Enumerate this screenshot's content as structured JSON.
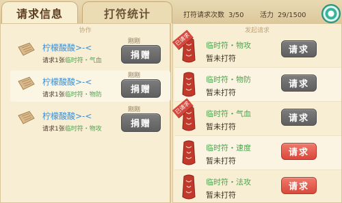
{
  "tabs": {
    "active": "请求信息",
    "inactive": "打符统计"
  },
  "stats": {
    "count_label": "打符请求次数",
    "count_value": "3/50",
    "vitality_label": "活力",
    "vitality_value": "29/1500"
  },
  "left_panel": {
    "header": "协作",
    "rows": [
      {
        "time": "刚刚",
        "name": "柠檬酸酸>-<",
        "req_prefix": "请求1张",
        "req_item": "临时符・气血",
        "button": "捐赠"
      },
      {
        "time": "刚刚",
        "name": "柠檬酸酸>-<",
        "req_prefix": "请求1张",
        "req_item": "临时符・物防",
        "button": "捐赠"
      },
      {
        "time": "刚刚",
        "name": "柠檬酸酸>-<",
        "req_prefix": "请求1张",
        "req_item": "临时符・物攻",
        "button": "捐赠"
      }
    ]
  },
  "right_panel": {
    "header": "发起请求",
    "rows": [
      {
        "badge": "已请求",
        "type": "临时符・物攻",
        "status": "暂未打符",
        "button": "请求",
        "button_state": "disabled"
      },
      {
        "badge": "",
        "type": "临时符・物防",
        "status": "暂未打符",
        "button": "请求",
        "button_state": "disabled"
      },
      {
        "badge": "已请求",
        "type": "临时符・气血",
        "status": "暂未打符",
        "button": "请求",
        "button_state": "disabled"
      },
      {
        "badge": "",
        "type": "临时符・速度",
        "status": "暂未打符",
        "button": "请求",
        "button_state": "active"
      },
      {
        "badge": "",
        "type": "临时符・法攻",
        "status": "暂未打符",
        "button": "请求",
        "button_state": "active"
      }
    ]
  },
  "colors": {
    "name_blue": "#3c8fd2",
    "item_green": "#4ca34e",
    "button_gray": "#6b6b6b",
    "button_red": "#e05a4b"
  }
}
